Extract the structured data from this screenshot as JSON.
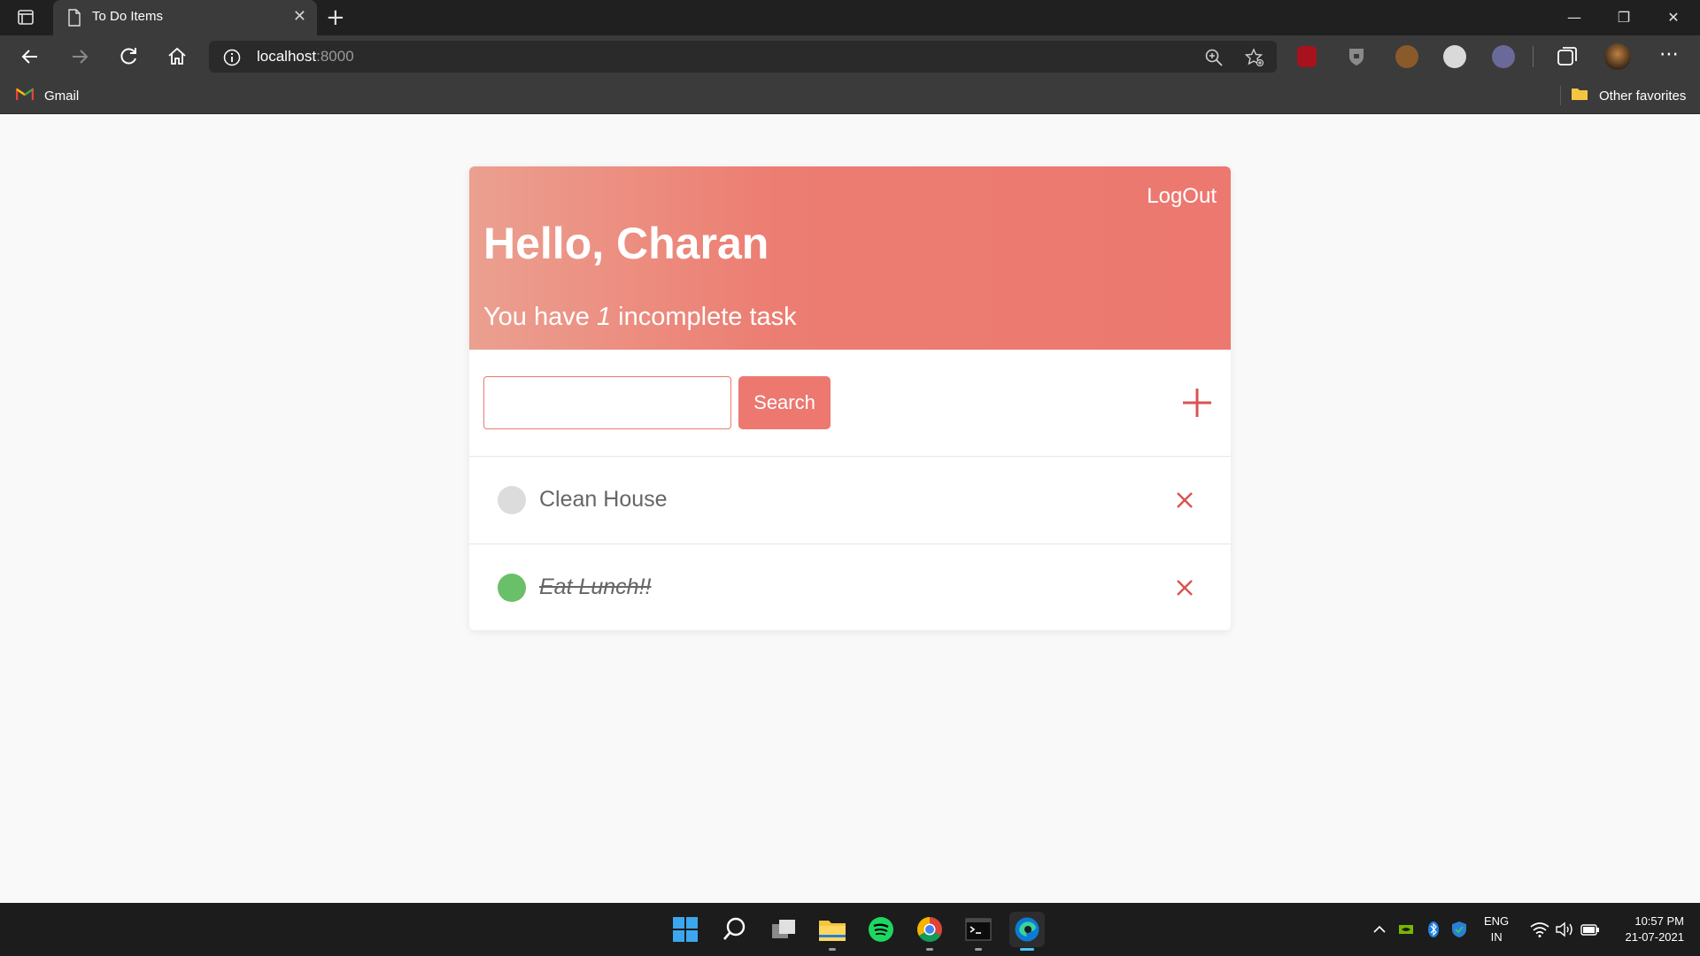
{
  "browser": {
    "tab_title": "To Do Items",
    "tab_close": "✕",
    "new_tab": "+",
    "url_host": "localhost",
    "url_port": ":8000",
    "bookmarks": [
      {
        "label": "Gmail",
        "icon": "gmail-icon"
      },
      {
        "label": "Other favorites",
        "icon": "folder-icon"
      }
    ],
    "window_controls": {
      "minimize": "—",
      "restore": "❐",
      "close": "✕"
    }
  },
  "page": {
    "logout_label": "LogOut",
    "greeting": "Hello, Charan",
    "summary_prefix": "You have",
    "incomplete_count": "1",
    "summary_suffix": "incomplete task",
    "search": {
      "value": "",
      "placeholder": "",
      "button_label": "Search"
    },
    "tasks": [
      {
        "text": "Clean House",
        "completed": false,
        "check_color": "#dcdcdc"
      },
      {
        "text": "Eat Lunch!!",
        "completed": true,
        "check_color": "#6abf69"
      }
    ],
    "colors": {
      "accent": "#ec7870",
      "header_start": "#eba090",
      "complete": "#6abf69",
      "delete": "#d9534f"
    }
  },
  "taskbar": {
    "apps": [
      "windows-start-icon",
      "search-icon",
      "task-view-icon",
      "file-explorer-icon",
      "spotify-icon",
      "chrome-icon",
      "terminal-icon",
      "edge-icon"
    ],
    "language_line1": "ENG",
    "language_line2": "IN",
    "time": "10:57 PM",
    "date": "21-07-2021"
  }
}
